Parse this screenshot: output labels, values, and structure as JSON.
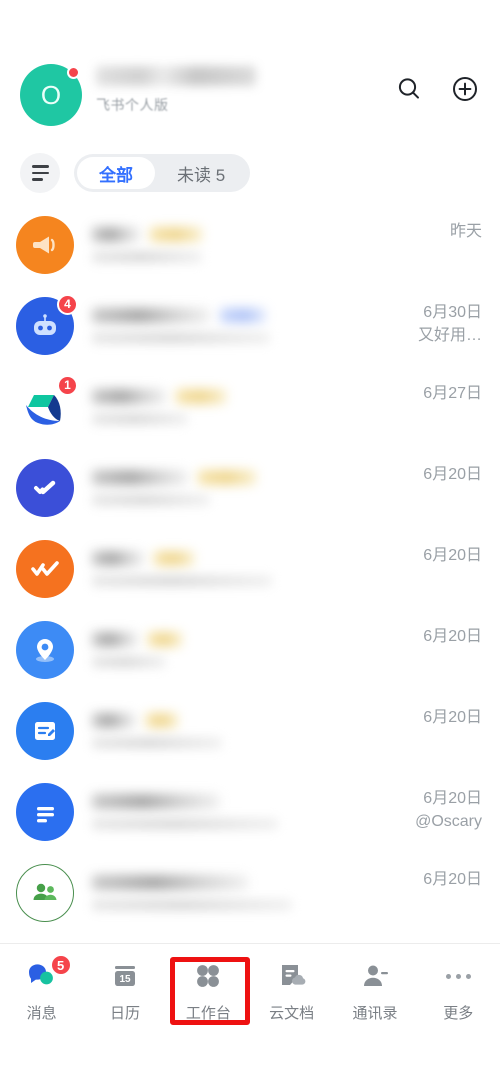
{
  "app": {
    "name": "Feishu Messages"
  },
  "header": {
    "avatar": {
      "initial": "O",
      "color": "#1fc7a3",
      "has_unread_dot": true,
      "dot_color": "#f5444b"
    },
    "display_name_redacted": true,
    "subtitle": "飞书个人版",
    "search_icon": "search-icon",
    "add_icon": "plus-circle-icon"
  },
  "filter": {
    "filter_icon": "filter-lines-icon",
    "tabs": [
      {
        "label": "全部",
        "active": true,
        "color": "#3370ff"
      },
      {
        "label": "未读 5",
        "active": false
      }
    ]
  },
  "chats": [
    {
      "avatar": "megaphone-icon",
      "avatar_color": "#f5851f",
      "badge": null,
      "timestamp": "昨天",
      "mention": null,
      "title_w": 48,
      "tag_w": 52,
      "sub_w": 110,
      "sub2_w": 0,
      "blue_w": 0
    },
    {
      "avatar": "robot-icon",
      "avatar_color": "#2b5fe3",
      "badge": "4",
      "timestamp": "6月30日",
      "mention": "又好用…",
      "title_w": 118,
      "tag_w": 0,
      "sub_w": 0,
      "sub2_w": 178,
      "blue_w": 46
    },
    {
      "avatar": "feishu-logo-icon",
      "avatar_color": "#ffffff",
      "badge": "1",
      "timestamp": "6月27日",
      "mention": null,
      "title_w": 74,
      "tag_w": 50,
      "sub_w": 96,
      "sub2_w": 0,
      "blue_w": 0
    },
    {
      "avatar": "check-task-icon",
      "avatar_color": "#3b4fd8",
      "badge": null,
      "timestamp": "6月20日",
      "mention": null,
      "title_w": 96,
      "tag_w": 58,
      "sub_w": 118,
      "sub2_w": 0,
      "blue_w": 0
    },
    {
      "avatar": "double-check-icon",
      "avatar_color": "#f5721f",
      "badge": null,
      "timestamp": "6月20日",
      "mention": null,
      "title_w": 52,
      "tag_w": 40,
      "sub_w": 180,
      "sub2_w": 0,
      "blue_w": 0
    },
    {
      "avatar": "location-pin-icon",
      "avatar_color": "#3d8bf5",
      "badge": null,
      "timestamp": "6月20日",
      "mention": null,
      "title_w": 46,
      "tag_w": 34,
      "sub_w": 74,
      "sub2_w": 0,
      "blue_w": 0
    },
    {
      "avatar": "approval-form-icon",
      "avatar_color": "#2b7ef0",
      "badge": null,
      "timestamp": "6月20日",
      "mention": null,
      "title_w": 44,
      "tag_w": 32,
      "sub_w": 130,
      "sub2_w": 0,
      "blue_w": 0
    },
    {
      "avatar": "doc-lines-icon",
      "avatar_color": "#2b6ff0",
      "badge": null,
      "timestamp": "6月20日",
      "mention": "@Oscary",
      "title_w": 128,
      "tag_w": 0,
      "sub_w": 186,
      "sub2_w": 0,
      "blue_w": 0
    },
    {
      "avatar": "group-people-icon",
      "avatar_color": "#4a8f4f",
      "badge": null,
      "timestamp": "6月20日",
      "mention": null,
      "title_w": 156,
      "tag_w": 0,
      "sub_w": 200,
      "sub2_w": 0,
      "blue_w": 0
    }
  ],
  "tabbar": {
    "items": [
      {
        "label": "消息",
        "icon": "chat-bubbles-icon",
        "badge": "5",
        "selected": false
      },
      {
        "label": "日历",
        "icon": "calendar-icon",
        "calendar_day": "15",
        "badge": null,
        "selected": false
      },
      {
        "label": "工作台",
        "icon": "apps-grid-icon",
        "badge": null,
        "selected": false,
        "highlighted": true
      },
      {
        "label": "云文档",
        "icon": "cloud-doc-icon",
        "badge": null,
        "selected": false
      },
      {
        "label": "通讯录",
        "icon": "contacts-icon",
        "badge": null,
        "selected": false
      },
      {
        "label": "更多",
        "icon": "more-dots-icon",
        "badge": null,
        "selected": false
      }
    ],
    "highlight_color": "#ee1111"
  }
}
